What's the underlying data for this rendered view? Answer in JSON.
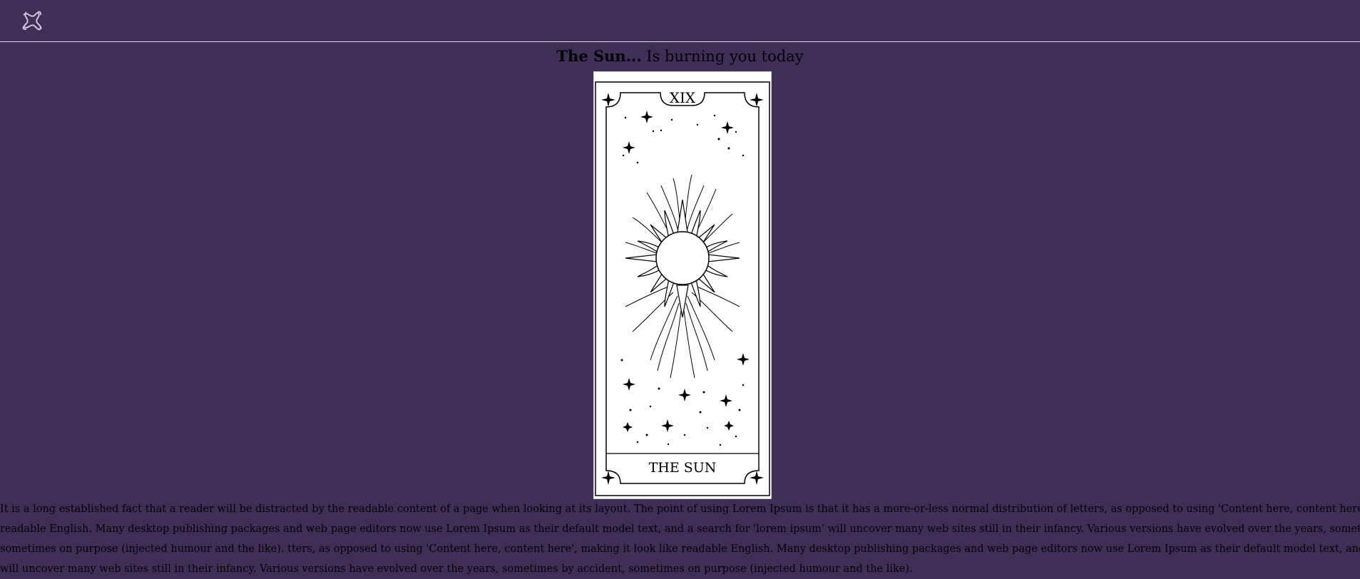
{
  "header": {
    "logo_icon": "knot-logo-icon"
  },
  "heading": {
    "bold": "The Sun...",
    "rest": " Is burning you today"
  },
  "card": {
    "numeral": "XIX",
    "name": "THE SUN"
  },
  "body": {
    "lines": [
      "It is a long established fact that a reader will be distracted by the readable content of a page when looking at its layout. The point of using Lorem Ipsum is that it has a more-or-less normal distribution of letters, as opposed to using 'Content here, content here', making it look like",
      "readable English. Many desktop publishing packages and web page editors now use Lorem Ipsum as their default model text, and a search for 'lorem ipsum' will uncover many web sites still in their infancy. Various versions have evolved over the years, sometimes by accident,",
      "sometimes on purpose (injected humour and the like). tters, as opposed to using 'Content here, content here', making it look like readable English. Many desktop publishing packages and web page editors now use Lorem Ipsum as their default model text, and a search for 'lorem ipsum'",
      "will uncover many web sites still in their infancy. Various versions have evolved over the years, sometimes by accident, sometimes on purpose (injected humour and the like)."
    ]
  },
  "colors": {
    "background": "#3f2f56",
    "divider": "#e8e2ef",
    "card": "#ffffff"
  }
}
